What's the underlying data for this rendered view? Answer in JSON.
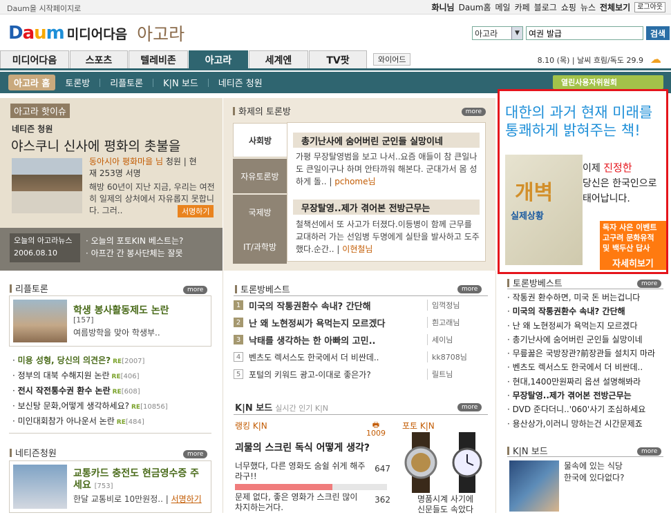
{
  "top": {
    "start_page": "Daum을 시작페이지로",
    "user": "화니님",
    "links": [
      "Daum홈",
      "메일",
      "카페",
      "블로그",
      "쇼핑",
      "뉴스"
    ],
    "all_view": "전체보기",
    "logout": "로그아웃"
  },
  "logo": {
    "brand": "Daum",
    "sub": "미디어다음",
    "section": "아고라"
  },
  "search": {
    "scope": "아고라",
    "query": "여권 발급",
    "button": "검색"
  },
  "tabs": [
    "미디어다음",
    "스포츠",
    "텔레비존",
    "아고라",
    "세계엔",
    "TV팟"
  ],
  "wire_tab": "와이어드",
  "date": "8.10 (목)",
  "weather": "날씨 흐림/독도 29.9",
  "subnav": [
    "아고라 홈",
    "토론방",
    "리플토론",
    "K|N 보드",
    "네티즌 청원"
  ],
  "clean_banner": "열린사용자위원회",
  "hot_issue": {
    "header": "아고라 핫이슈",
    "category": "네티즌 청원",
    "title": "야스쿠니 신사에 평화의 촛불을",
    "author": "동아시아 평화마을 님",
    "meta_rest": "청원 | 현재 253명 서명",
    "body": "해방 60년이 지난 지금, 우리는 여전히 일제의 상처에서 자유롭지 못합니다. 그러..",
    "sign_button": "서명하기"
  },
  "news": {
    "label1": "오늘의 아고라뉴스",
    "date": "2006.08.10",
    "items": [
      "· 오늘의 포토KIN 베스트는?",
      "· 아프간 간 봉사단체는 잘못"
    ]
  },
  "debate": {
    "header": "화제의 토론방",
    "more": "more",
    "tabs": [
      "사회방",
      "자유토론방",
      "국제방",
      "IT/과학방"
    ],
    "items": [
      {
        "title": "총기난사에 숨어버린 군인들 실망이네",
        "body": "가평 무장탈영범을 보고 나서..요즘 애들이 참 큰일나도 큰일이구나 하며 안타까워 해본다. 군대가서 몸 성하게 돌..",
        "author": "pchome님"
      },
      {
        "title": "무장탈영..제가 겪어본 전방근무는",
        "body": "철책선에서 또 사고가 터졌다.이등병이 함께 근무를 교대하러 가는 선임병 두명에게 실탄을 발사하고 도주했다.순간..",
        "author": "이현철님"
      }
    ]
  },
  "ad": {
    "headline1": "대한의 과거 현재 미래를",
    "headline2": "통쾌하게 밝혀주는 책!",
    "book_title": "개벽",
    "book_sub": "실제상황",
    "line1": "이제",
    "line2": "진정한",
    "line3": "당신은",
    "line4": "한국인으로",
    "line5": "태어납니다.",
    "event_line1": "독자 사은 이벤트",
    "event_line2": "고구려 문화유적",
    "event_line3": "및 백두산 답사",
    "button": "자세히보기"
  },
  "riple": {
    "header": "리플토론",
    "featured": {
      "title": "학생 봉사활동제도 논란",
      "count": "[157]",
      "desc": "여름방학을 맞아 학생부.."
    },
    "items": [
      {
        "text": "미용 성형, 당신의 의견은?",
        "n": "[2007]",
        "hl": true
      },
      {
        "text": "정부의 대북 수해지원 논란",
        "n": "[406]",
        "hl": false
      },
      {
        "text": "전시 작전통수권 환수 논란",
        "n": "[608]",
        "hl": false
      },
      {
        "text": "보신탕 문화,어떻게 생각하세요?",
        "n": "[10856]",
        "hl": false
      },
      {
        "text": "미인대회참가 아나운서 논란",
        "n": "[484]",
        "hl": false
      }
    ]
  },
  "petition": {
    "header": "네티즌청원",
    "title": "교통카드 충전도 현금영수증 주세요",
    "count": "[753]",
    "desc": "한달 교통비로 10만원정..",
    "sign": "서명하기"
  },
  "best_mid": {
    "header": "토론방베스트",
    "items": [
      {
        "n": "1",
        "t": "미국의 작통권환수 속내? 간단해",
        "a": "임꺽정님"
      },
      {
        "n": "2",
        "t": "난 왜 노현정씨가 욕먹는지 모르겠다",
        "a": "흰고래님"
      },
      {
        "n": "3",
        "t": "낙태를 생각하는 한 아빠의 고민..",
        "a": "세이님"
      },
      {
        "n": "4",
        "t": "벤츠도 렉서스도 한국에서 더 비싼데..",
        "a": "kk8708님"
      },
      {
        "n": "5",
        "t": "포털의 키워드 광고-이대로 좋은가?",
        "a": "릴트님"
      }
    ]
  },
  "best_right": {
    "header": "토론방베스트",
    "items": [
      "작통권 환수하면, 미국 돈 버는겁니다",
      "미국의 작통권환수 속내? 간단해",
      "난 왜 노현정씨가 욕먹는지 모르겠다",
      "총기난사에 숨어버린 군인들 실망이네",
      "무릎꿇은 국방장관?前장관들 설치지 마라",
      "벤츠도 렉서스도 한국에서 더 비싼데..",
      "현대,1400만원짜리 옵션 설명해봐라",
      "무장탈영..제가 겪어본 전방근무는",
      "DVD 준다더니..'060'사기 조심하세요",
      "용산상가,이러니 망하는건 시간문제죠"
    ]
  },
  "kin": {
    "header": "K|N 보드",
    "realtime": "실시간 인기 K|N",
    "rank_label": "랭킹 K|N",
    "rank_count": "1009",
    "question": "괴물의 스크린 독식 어떻게 생각?",
    "answers": [
      {
        "text": "너무했다, 다른 영화도 숨쉴 쉬게 해주라구!!",
        "count": "647",
        "ratio": 0.64
      },
      {
        "text": "문제 없다, 좋은 영화가 스크린 많이 차지하는거다.",
        "count": "362",
        "ratio": 0.36
      }
    ],
    "photo_label": "포토 K|N",
    "photo_caption1": "명품시계 사기에",
    "photo_caption2": "신문들도 속았다",
    "right_header": "K|N 보드",
    "right_text1": "물속에 있는 식당",
    "right_text2": "한국에 있다없다?"
  },
  "more_label": "more"
}
